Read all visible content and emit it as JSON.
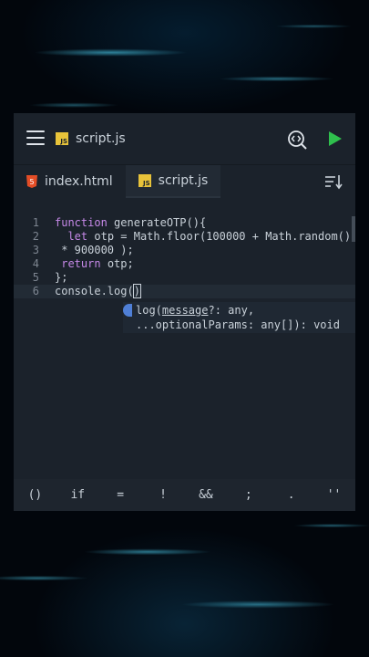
{
  "topbar": {
    "filename": "script.js",
    "js_badge": "JS"
  },
  "tabs": [
    {
      "label": "index.html",
      "icon": "html5-icon",
      "active": false
    },
    {
      "label": "script.js",
      "icon": "js-icon",
      "active": true
    }
  ],
  "editor": {
    "line_numbers": [
      "1",
      "2",
      "3",
      "4",
      "5",
      "6"
    ],
    "lines": {
      "l1_kw": "function",
      "l1_rest": " generateOTP(){",
      "l2_kw": "let",
      "l2_rest": " otp = Math.floor(100000 + Math.random()",
      "l3": " * 900000 );",
      "l4_kw": "return",
      "l4_rest": " otp;",
      "l5": "};",
      "l6_a": "console.log(",
      "l6_b": ")"
    }
  },
  "hint": {
    "line1_a": "log(",
    "line1_param": "message",
    "line1_b": "?: any,",
    "line2": "...optionalParams: any[]): void"
  },
  "keys": [
    "()",
    "if",
    "=",
    "!",
    "&&",
    ";",
    ".",
    "''"
  ]
}
